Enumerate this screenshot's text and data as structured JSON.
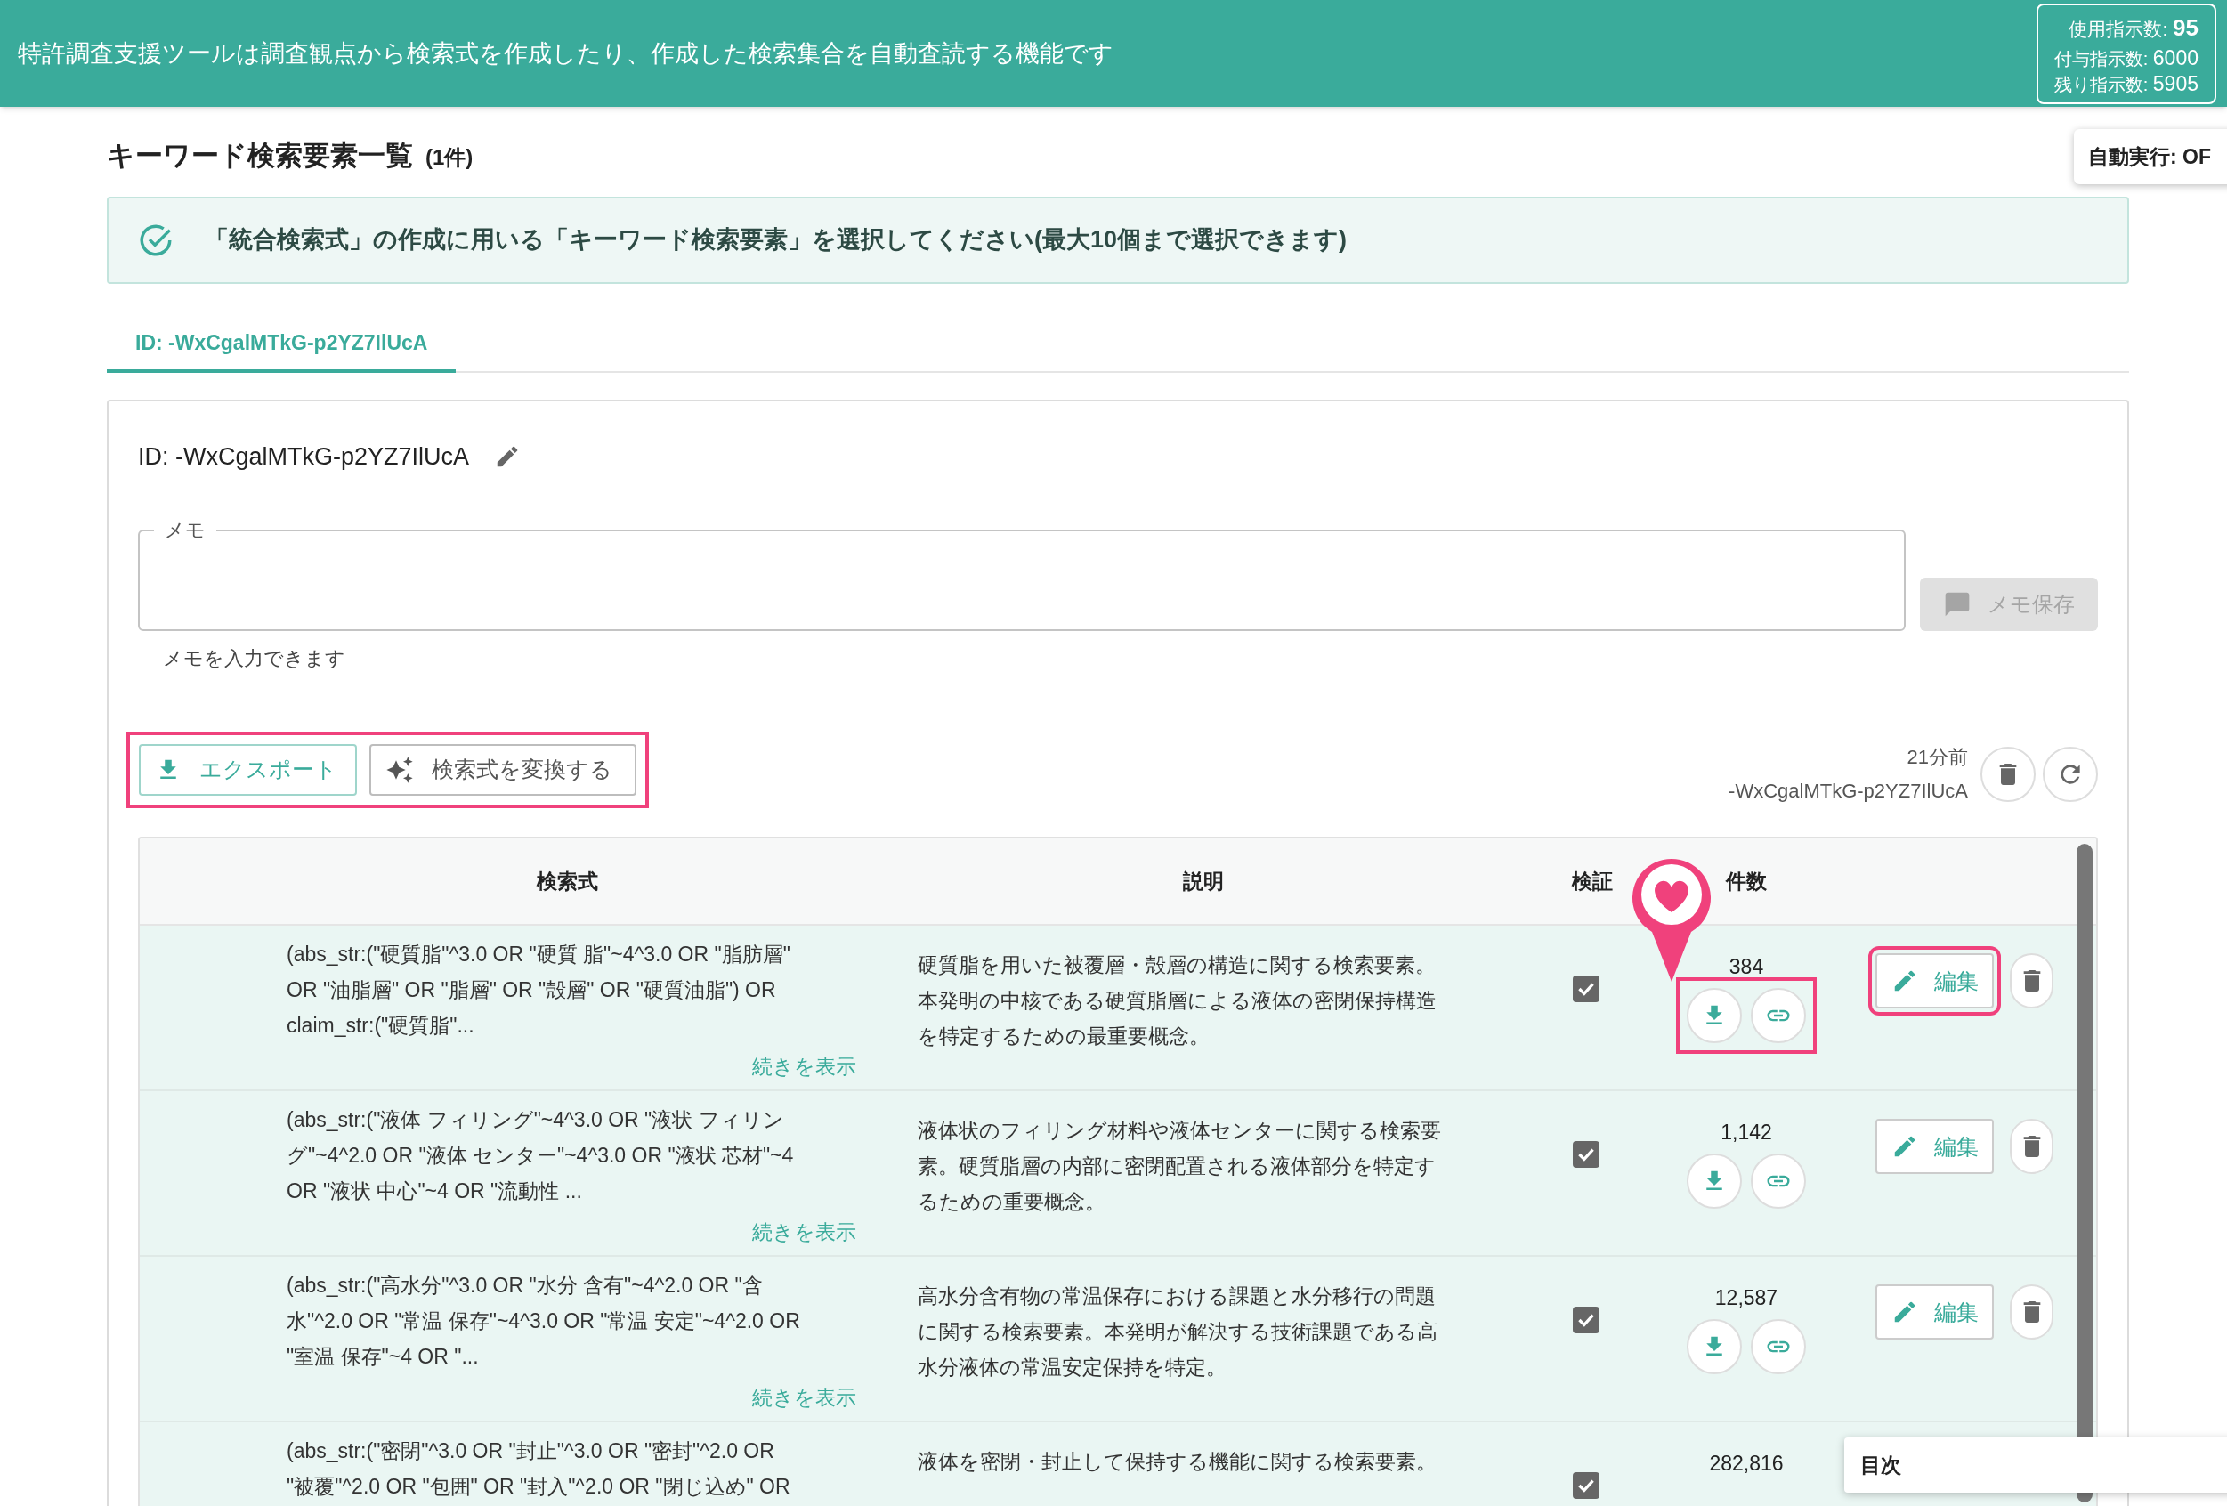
{
  "banner": {
    "text": "特許調査支援ツールは調査観点から検索式を作成したり、作成した検索集合を自動査読する機能です",
    "usage": [
      {
        "label": "使用指示数:",
        "value": "95",
        "kind": "main"
      },
      {
        "label": "付与指示数:",
        "value": "6000",
        "kind": "sub"
      },
      {
        "label": "残り指示数:",
        "value": "5905",
        "kind": "sub"
      }
    ]
  },
  "auto_run": {
    "label": "自動実行: OF"
  },
  "page_title": {
    "title": "キーワード検索要素一覧",
    "count": "(1件)"
  },
  "alert": {
    "text": "「統合検索式」の作成に用いる「キーワード検索要素」を選択してください(最大10個まで選択できます)"
  },
  "tabs": [
    {
      "label": "ID: -WxCgalMTkG-p2YZ7IlUcA",
      "selected": true
    }
  ],
  "card": {
    "id_label": "ID: -WxCgalMTkG-p2YZ7IlUcA",
    "memo": {
      "label": "メモ",
      "helper": "メモを入力できます"
    },
    "memo_save": {
      "label": "メモ保存",
      "disabled": true
    },
    "buttons": [
      {
        "label": "エクスポート",
        "kind": "export"
      },
      {
        "label": "検索式を変換する",
        "kind": "convert"
      }
    ],
    "updated": "21分前",
    "updated_id": "-WxCgalMTkG-p2YZ7IlUcA"
  },
  "table": {
    "columns": [
      "検索式",
      "説明",
      "検証",
      "件数"
    ],
    "rows": [
      {
        "query": [
          "(abs_str:(\"硬質脂\"^3.0 OR \"硬質 脂\"~4^3.0 OR \"脂肪層\"",
          "OR \"油脂層\" OR \"脂層\" OR \"殻層\" OR \"硬質油脂\") OR",
          "claim_str:(\"硬質脂\"..."
        ],
        "more": "続きを表示",
        "description": [
          "硬質脂を用いた被覆層・殻層の構造に関する検索要素。",
          "本発明の中核である硬質脂層による液体の密閉保持構造",
          "を特定するための最重要概念。"
        ],
        "checked": true,
        "count": "384",
        "edit": "編集"
      },
      {
        "query": [
          "(abs_str:(\"液体 フィリング\"~4^3.0 OR \"液状 フィリン",
          "グ\"~4^2.0 OR \"液体 センター\"~4^3.0 OR \"液状 芯材\"~4",
          "OR \"液状 中心\"~4 OR \"流動性 ..."
        ],
        "more": "続きを表示",
        "description": [
          "液体状のフィリング材料や液体センターに関する検索要",
          "素。硬質脂層の内部に密閉配置される液体部分を特定す",
          "るための重要概念。"
        ],
        "checked": true,
        "count": "1,142",
        "edit": "編集"
      },
      {
        "query": [
          "(abs_str:(\"高水分\"^3.0 OR \"水分 含有\"~4^2.0 OR \"含",
          "水\"^2.0 OR \"常温 保存\"~4^3.0 OR \"常温 安定\"~4^2.0 OR",
          "\"室温 保存\"~4 OR \"..."
        ],
        "more": "続きを表示",
        "description": [
          "高水分含有物の常温保存における課題と水分移行の問題",
          "に関する検索要素。本発明が解決する技術課題である高",
          "水分液体の常温安定保持を特定。"
        ],
        "checked": true,
        "count": "12,587",
        "edit": "編集"
      },
      {
        "query": [
          "(abs_str:(\"密閉\"^3.0 OR \"封止\"^3.0 OR \"密封\"^2.0 OR",
          "\"被覆\"^2.0 OR \"包囲\" OR \"封入\"^2.0 OR \"閉じ込め\" OR"
        ],
        "description": [
          "液体を密閉・封止して保持する機能に関する検索要素。"
        ],
        "checked": true,
        "count": "282,816"
      }
    ]
  },
  "toc": {
    "label": "目次"
  }
}
